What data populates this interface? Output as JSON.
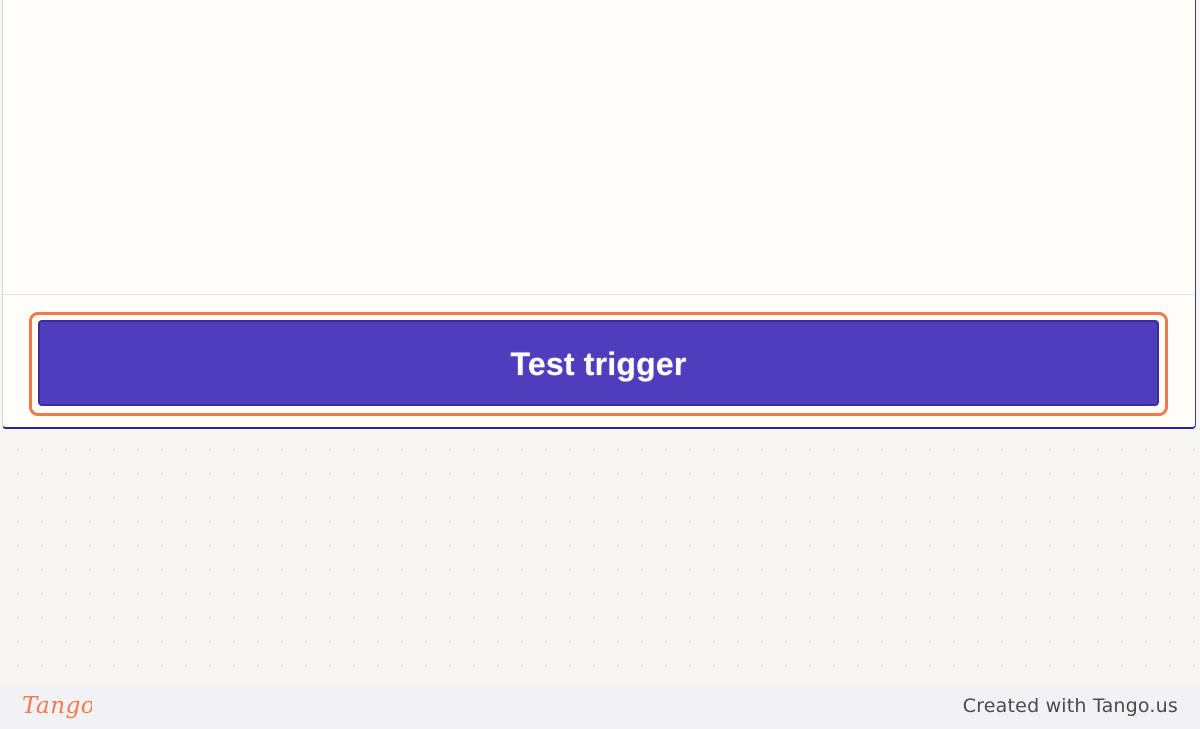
{
  "panel": {
    "primary_button_label": "Test trigger"
  },
  "footer": {
    "logo_text": "Tango",
    "credit_text": "Created with Tango.us"
  },
  "colors": {
    "button_bg": "#503dbd",
    "highlight_ring": "#f07a48",
    "panel_bg": "#fffdf9",
    "canvas_bg": "#f7f6f3",
    "footer_bg": "#f2f1f6",
    "logo": "#f07a48"
  },
  "icons": {
    "logo": "tango-logo-icon"
  }
}
